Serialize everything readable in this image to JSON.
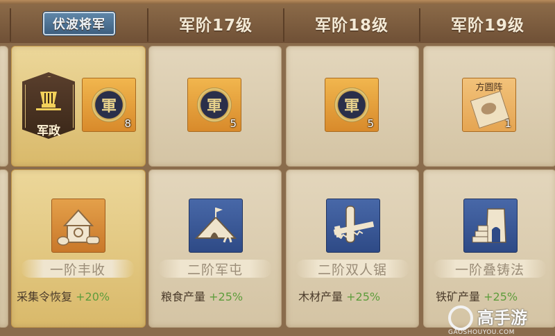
{
  "header": {
    "current_rank": "伏波将军",
    "columns": [
      "军阶17级",
      "军阶18级",
      "军阶19级"
    ]
  },
  "row1": {
    "special_item": {
      "label": "军政",
      "icon": "general-hat-icon"
    },
    "items": [
      {
        "icon": "command-token-icon",
        "glyph": "軍",
        "count": "8"
      },
      {
        "icon": "command-token-icon",
        "glyph": "軍",
        "count": "5"
      },
      {
        "icon": "command-token-icon",
        "glyph": "軍",
        "count": "5"
      },
      {
        "icon": "formation-scroll-icon",
        "label": "方圆阵",
        "count": "1"
      }
    ]
  },
  "row2": {
    "techs": [
      {
        "icon": "granary-icon",
        "name": "一阶丰收",
        "effect": "采集令恢复",
        "bonus": "+20%"
      },
      {
        "icon": "army-camp-icon",
        "name": "二阶军屯",
        "effect": "粮食产量",
        "bonus": "+25%"
      },
      {
        "icon": "saw-icon",
        "name": "二阶双人锯",
        "effect": "木材产量",
        "bonus": "+25%"
      },
      {
        "icon": "forge-icon",
        "name": "一阶叠铸法",
        "effect": "铁矿产量",
        "bonus": "+25%"
      }
    ]
  },
  "watermark": {
    "title": "高手游",
    "url": "GAOSHOUYOU.COM"
  },
  "colors": {
    "active_cell": "#e2c47f",
    "bonus_green": "#5e9d3c",
    "header_text": "#f4ead6"
  }
}
